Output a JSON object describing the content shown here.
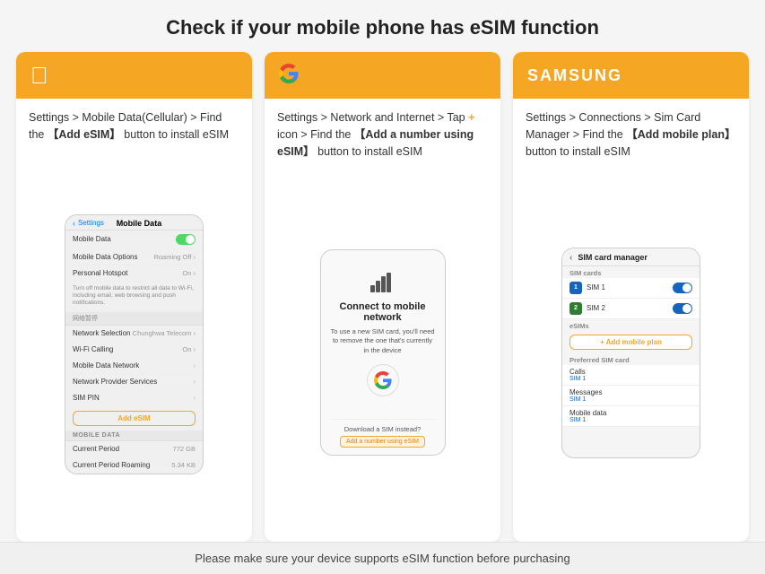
{
  "title": "Check if your mobile phone has eSIM function",
  "footer": "Please make sure your device supports eSIM function before purchasing",
  "cards": [
    {
      "id": "apple",
      "brand": "apple",
      "description": "Settings > Mobile Data(Cellular) > Find the 【Add eSIM】 button to install eSIM",
      "phone": {
        "backLabel": "Settings",
        "pageTitle": "Mobile Data",
        "items": [
          {
            "label": "Mobile Data",
            "type": "toggle-on"
          },
          {
            "label": "Mobile Data Options",
            "value": "Roaming Off",
            "type": "arrow"
          },
          {
            "label": "Personal Hotspot",
            "value": "On",
            "type": "arrow"
          },
          {
            "label": "Turn off mobile data to restrict all data to Wi-Fi, including email, web browsing and push notifications.",
            "type": "info"
          },
          {
            "label": "网络暂停",
            "type": "section-header"
          },
          {
            "label": "Network Selection",
            "value": "Chunghwa Telecom",
            "type": "arrow"
          },
          {
            "label": "Wi-Fi Calling",
            "value": "On",
            "type": "arrow"
          },
          {
            "label": "Mobile Data Network",
            "type": "arrow"
          },
          {
            "label": "Network Provider Services",
            "type": "arrow"
          },
          {
            "label": "SIM PIN",
            "type": "arrow"
          }
        ],
        "addEsimLabel": "Add eSIM",
        "mobileDataSection": "MOBILE DATA",
        "currentPeriod": "Current Period",
        "currentPeriodValue": "772 GB",
        "currentPeriodRoaming": "Current Period Roaming",
        "currentPeriodRoamingValue": "5.34 KB"
      }
    },
    {
      "id": "google",
      "brand": "google",
      "description_parts": [
        {
          "text": "Settings > Network and Internet > Tap "
        },
        {
          "text": "+",
          "orange": true
        },
        {
          "text": " icon > Find the "
        },
        {
          "text": "【Add a number using eSIM】",
          "bold": true
        },
        {
          "text": " button to install eSIM"
        }
      ],
      "description": "Settings > Network and Internet > Tap + icon > Find the 【Add a number using eSIM】 button to install eSIM",
      "phone": {
        "connectTitle": "Connect to mobile network",
        "connectDesc": "To use a new SIM card, you'll need to remove the one that's currently in the device",
        "downloadText": "Download a SIM instead?",
        "addBtn": "Add a number using eSIM"
      }
    },
    {
      "id": "samsung",
      "brand": "samsung",
      "description": "Settings > Connections > Sim Card Manager > Find the 【Add mobile plan】 button to install eSIM",
      "phone": {
        "backLabel": "",
        "pageTitle": "SIM card manager",
        "simCardsSection": "SIM cards",
        "sims": [
          {
            "label": "SIM 1",
            "color": "blue",
            "letter": "1"
          },
          {
            "label": "SIM 2",
            "color": "green",
            "letter": "2"
          }
        ],
        "esimsSection": "eSIMs",
        "addPlanLabel": "+ Add mobile plan",
        "preferredSection": "Preferred SIM card",
        "preferredItems": [
          {
            "label": "Calls",
            "sublabel": "SIM 1"
          },
          {
            "label": "Messages",
            "sublabel": "SIM 1"
          },
          {
            "label": "Mobile data",
            "sublabel": "SIM 1"
          }
        ]
      }
    }
  ]
}
